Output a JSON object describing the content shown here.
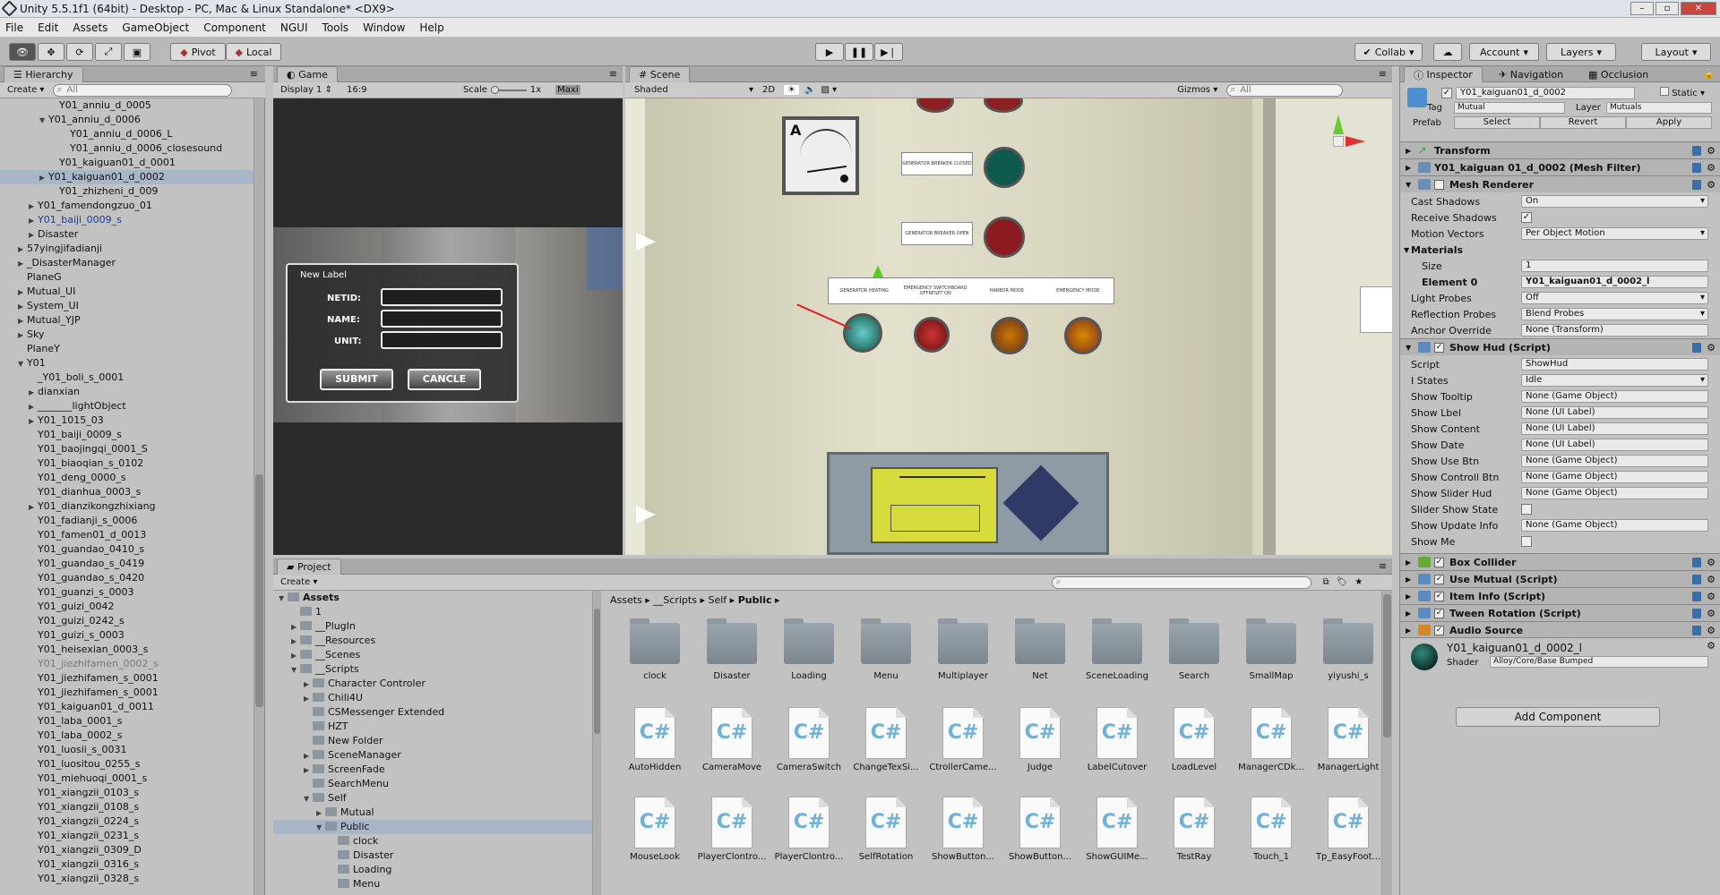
{
  "window": {
    "title": "Unity 5.5.1f1 (64bit) - Desktop - PC, Mac & Linux Standalone* <DX9>"
  },
  "menu": [
    "File",
    "Edit",
    "Assets",
    "GameObject",
    "Component",
    "NGUI",
    "Tools",
    "Window",
    "Help"
  ],
  "toolbar": {
    "pivot": "Pivot",
    "local": "Local",
    "collab": "Collab",
    "account": "Account",
    "layers": "Layers",
    "layout": "Layout"
  },
  "hierarchy": {
    "tab": "Hierarchy",
    "create": "Create",
    "search_placeholder": "All",
    "rows": [
      {
        "label": "Y01_anniu_d_0005",
        "indent": 4,
        "arrow": ""
      },
      {
        "label": "Y01_anniu_d_0006",
        "indent": 3,
        "arrow": "▼"
      },
      {
        "label": "Y01_anniu_d_0006_L",
        "indent": 5,
        "arrow": ""
      },
      {
        "label": "Y01_anniu_d_0006_closesound",
        "indent": 5,
        "arrow": ""
      },
      {
        "label": "Y01_kaiguan01_d_0001",
        "indent": 4,
        "arrow": ""
      },
      {
        "label": "Y01_kaiguan01_d_0002",
        "indent": 3,
        "arrow": "▶",
        "state": "sel"
      },
      {
        "label": "Y01_zhizheni_d_009",
        "indent": 4,
        "arrow": ""
      },
      {
        "label": "Y01_famendongzuo_01",
        "indent": 2,
        "arrow": "▶"
      },
      {
        "label": "Y01_baiji_0009_s",
        "indent": 2,
        "arrow": "▶",
        "state": "prefab"
      },
      {
        "label": "Disaster",
        "indent": 2,
        "arrow": "▶"
      },
      {
        "label": "57yingjifadianji",
        "indent": 1,
        "arrow": "▶"
      },
      {
        "label": "_DisasterManager",
        "indent": 1,
        "arrow": "▶"
      },
      {
        "label": "PlaneG",
        "indent": 1,
        "arrow": ""
      },
      {
        "label": "Mutual_UI",
        "indent": 1,
        "arrow": "▶"
      },
      {
        "label": "System_UI",
        "indent": 1,
        "arrow": "▶"
      },
      {
        "label": "Mutual_YJP",
        "indent": 1,
        "arrow": "▶"
      },
      {
        "label": "Sky",
        "indent": 1,
        "arrow": "▶"
      },
      {
        "label": "PlaneY",
        "indent": 1,
        "arrow": ""
      },
      {
        "label": "Y01",
        "indent": 1,
        "arrow": "▼"
      },
      {
        "label": "_Y01_boli_s_0001",
        "indent": 2,
        "arrow": ""
      },
      {
        "label": "dianxian",
        "indent": 2,
        "arrow": "▶"
      },
      {
        "label": "_______lightObject",
        "indent": 2,
        "arrow": "▶"
      },
      {
        "label": "Y01_1015_03",
        "indent": 2,
        "arrow": "▶"
      },
      {
        "label": "Y01_baiji_0009_s",
        "indent": 2,
        "arrow": ""
      },
      {
        "label": "Y01_baojingqi_0001_S",
        "indent": 2,
        "arrow": ""
      },
      {
        "label": "Y01_biaoqian_s_0102",
        "indent": 2,
        "arrow": ""
      },
      {
        "label": "Y01_deng_0000_s",
        "indent": 2,
        "arrow": ""
      },
      {
        "label": "Y01_dianhua_0003_s",
        "indent": 2,
        "arrow": ""
      },
      {
        "label": "Y01_dianzikongzhixiang",
        "indent": 2,
        "arrow": "▶"
      },
      {
        "label": "Y01_fadianji_s_0006",
        "indent": 2,
        "arrow": ""
      },
      {
        "label": "Y01_famen01_d_0013",
        "indent": 2,
        "arrow": ""
      },
      {
        "label": "Y01_guandao_0410_s",
        "indent": 2,
        "arrow": ""
      },
      {
        "label": "Y01_guandao_s_0419",
        "indent": 2,
        "arrow": ""
      },
      {
        "label": "Y01_guandao_s_0420",
        "indent": 2,
        "arrow": ""
      },
      {
        "label": "Y01_guanzi_s_0003",
        "indent": 2,
        "arrow": ""
      },
      {
        "label": "Y01_guizi_0042",
        "indent": 2,
        "arrow": ""
      },
      {
        "label": "Y01_guizi_0242_s",
        "indent": 2,
        "arrow": ""
      },
      {
        "label": "Y01_guizi_s_0003",
        "indent": 2,
        "arrow": ""
      },
      {
        "label": "Y01_heisexian_0003_s",
        "indent": 2,
        "arrow": ""
      },
      {
        "label": "Y01_jiezhifamen_0002_s",
        "indent": 2,
        "arrow": "",
        "state": "gray"
      },
      {
        "label": "Y01_jiezhifamen_s_0001",
        "indent": 2,
        "arrow": ""
      },
      {
        "label": "Y01_jiezhifamen_s_0001",
        "indent": 2,
        "arrow": ""
      },
      {
        "label": "Y01_kaiguan01_d_0011",
        "indent": 2,
        "arrow": ""
      },
      {
        "label": "Y01_laba_0001_s",
        "indent": 2,
        "arrow": ""
      },
      {
        "label": "Y01_laba_0002_s",
        "indent": 2,
        "arrow": ""
      },
      {
        "label": "Y01_luosii_s_0031",
        "indent": 2,
        "arrow": ""
      },
      {
        "label": "Y01_luositou_0255_s",
        "indent": 2,
        "arrow": ""
      },
      {
        "label": "Y01_miehuoqi_0001_s",
        "indent": 2,
        "arrow": ""
      },
      {
        "label": "Y01_xiangzii_0103_s",
        "indent": 2,
        "arrow": ""
      },
      {
        "label": "Y01_xiangzii_0108_s",
        "indent": 2,
        "arrow": ""
      },
      {
        "label": "Y01_xiangzii_0224_s",
        "indent": 2,
        "arrow": ""
      },
      {
        "label": "Y01_xiangzii_0231_s",
        "indent": 2,
        "arrow": ""
      },
      {
        "label": "Y01_xiangzii_0309_D",
        "indent": 2,
        "arrow": ""
      },
      {
        "label": "Y01_xiangzii_0316_s",
        "indent": 2,
        "arrow": ""
      },
      {
        "label": "Y01_xiangzii_0328_s",
        "indent": 2,
        "arrow": ""
      }
    ]
  },
  "game": {
    "tab": "Game",
    "display": "Display 1",
    "aspect": "16:9",
    "scale_label": "Scale",
    "scale_value": "1x",
    "maximize": "Maxi",
    "dialog": {
      "title": "New Label",
      "netid": "NETID:",
      "name": "NAME:",
      "unit": "UNIT:",
      "submit": "SUBMIT",
      "cancel": "CANCLE"
    }
  },
  "scene": {
    "tab": "Scene",
    "shading": "Shaded",
    "mode2d": "2D",
    "gizmos": "Gizmos",
    "search_placeholder": "All",
    "meter_letter": "A",
    "placards": [
      "GENERATOR BREAKER CLOSED",
      "GENERATOR BREAKER OPEN",
      "GENERATOR HEATING",
      "EMERGENCY SWITCHBOARD OFFRESET ON",
      "HARBOR MODE",
      "EMERGENCY MODE"
    ]
  },
  "inspector": {
    "tabs": [
      "Inspector",
      "Navigation",
      "Occlusion"
    ],
    "object_name": "Y01_kaiguan01_d_0002",
    "static_label": "Static",
    "tag_label": "Tag",
    "tag_value": "Mutual",
    "layer_label": "Layer",
    "layer_value": "Mutuals",
    "prefab_label": "Prefab",
    "prefab_select": "Select",
    "prefab_revert": "Revert",
    "prefab_apply": "Apply",
    "transform": "Transform",
    "mesh_filter": "Y01_kaiguan 01_d_0002 (Mesh Filter)",
    "mesh_renderer": "Mesh Renderer",
    "mr_fields": [
      {
        "k": "Cast Shadows",
        "v": "On",
        "type": "dd"
      },
      {
        "k": "Receive Shadows",
        "v": "✓",
        "type": "chk"
      },
      {
        "k": "Motion Vectors",
        "v": "Per Object Motion",
        "type": "dd"
      }
    ],
    "materials_label": "Materials",
    "size_label": "Size",
    "size_value": "1",
    "element0_label": "Element 0",
    "element0_value": "Y01_kaiguan01_d_0002_l",
    "mr_fields2": [
      {
        "k": "Light Probes",
        "v": "Off",
        "type": "dd"
      },
      {
        "k": "Reflection Probes",
        "v": "Blend Probes",
        "type": "dd"
      },
      {
        "k": "Anchor Override",
        "v": "None (Transform)",
        "type": "obj"
      }
    ],
    "show_hud": "Show Hud (Script)",
    "hud_fields": [
      {
        "k": "Script",
        "v": "ShowHud",
        "type": "obj"
      },
      {
        "k": "I States",
        "v": "Idle",
        "type": "dd"
      },
      {
        "k": "Show Tooltip",
        "v": "None (Game Object)",
        "type": "obj"
      },
      {
        "k": "Show Lbel",
        "v": "None (UI Label)",
        "type": "obj"
      },
      {
        "k": "Show Content",
        "v": "None (UI Label)",
        "type": "obj"
      },
      {
        "k": "Show Date",
        "v": "None (UI Label)",
        "type": "obj"
      },
      {
        "k": "Show Use Btn",
        "v": "None (Game Object)",
        "type": "obj"
      },
      {
        "k": "Show Controll Btn",
        "v": "None (Game Object)",
        "type": "obj"
      },
      {
        "k": "Show Slider Hud",
        "v": "None (Game Object)",
        "type": "obj"
      },
      {
        "k": "Slider Show State",
        "v": "",
        "type": "chk"
      },
      {
        "k": "Show Update Info",
        "v": "None (Game Object)",
        "type": "obj"
      },
      {
        "k": "Show Me",
        "v": "",
        "type": "chk"
      }
    ],
    "components": [
      "Box Collider",
      "Use Mutual (Script)",
      "Item Info (Script)",
      "Tween Rotation (Script)",
      "Audio Source"
    ],
    "material_name": "Y01_kaiguan01_d_0002_l",
    "shader_label": "Shader",
    "shader_value": "Alloy/Core/Base Bumped",
    "add_component": "Add Component"
  },
  "project": {
    "tab": "Project",
    "create": "Create",
    "tree": [
      {
        "label": "Assets",
        "indent": 0,
        "arrow": "▼",
        "bold": true
      },
      {
        "label": "1",
        "indent": 1,
        "arrow": ""
      },
      {
        "label": "__PlugIn",
        "indent": 1,
        "arrow": "▶"
      },
      {
        "label": "__Resources",
        "indent": 1,
        "arrow": "▶"
      },
      {
        "label": "__Scenes",
        "indent": 1,
        "arrow": "▶"
      },
      {
        "label": "__Scripts",
        "indent": 1,
        "arrow": "▼"
      },
      {
        "label": "Character Controler",
        "indent": 2,
        "arrow": "▶"
      },
      {
        "label": "Chili4U",
        "indent": 2,
        "arrow": "▶"
      },
      {
        "label": "CSMessenger Extended",
        "indent": 2,
        "arrow": ""
      },
      {
        "label": "HZT",
        "indent": 2,
        "arrow": ""
      },
      {
        "label": "New Folder",
        "indent": 2,
        "arrow": ""
      },
      {
        "label": "SceneManager",
        "indent": 2,
        "arrow": "▶"
      },
      {
        "label": "ScreenFade",
        "indent": 2,
        "arrow": "▶"
      },
      {
        "label": "SearchMenu",
        "indent": 2,
        "arrow": ""
      },
      {
        "label": "Self",
        "indent": 2,
        "arrow": "▼"
      },
      {
        "label": "Mutual",
        "indent": 3,
        "arrow": "▶"
      },
      {
        "label": "Public",
        "indent": 3,
        "arrow": "▼",
        "sel": true
      },
      {
        "label": "clock",
        "indent": 4,
        "arrow": ""
      },
      {
        "label": "Disaster",
        "indent": 4,
        "arrow": ""
      },
      {
        "label": "Loading",
        "indent": 4,
        "arrow": ""
      },
      {
        "label": "Menu",
        "indent": 4,
        "arrow": ""
      }
    ],
    "breadcrumb": [
      "Assets",
      "__Scripts",
      "Self",
      "Public"
    ],
    "folders": [
      "clock",
      "Disaster",
      "Loading",
      "Menu",
      "Multiplayer",
      "Net",
      "SceneLoading",
      "Search",
      "SmallMap",
      "yiyushi_s"
    ],
    "scripts_row1": [
      "AutoHidden",
      "CameraMove",
      "CameraSwitch",
      "ChangeTexSi...",
      "CtrollerCame...",
      "Judge",
      "LabelCutover",
      "LoadLevel",
      "ManagerCDk...",
      "ManagerLight"
    ],
    "scripts_row2": [
      "MouseLook",
      "PlayerClontro...",
      "PlayerClontro...",
      "SelfRotation",
      "ShowButton...",
      "ShowButton...",
      "ShowGUIMe...",
      "TestRay",
      "Touch_1",
      "Tp_EasyFoot..."
    ],
    "cs_glyph": "C#"
  }
}
